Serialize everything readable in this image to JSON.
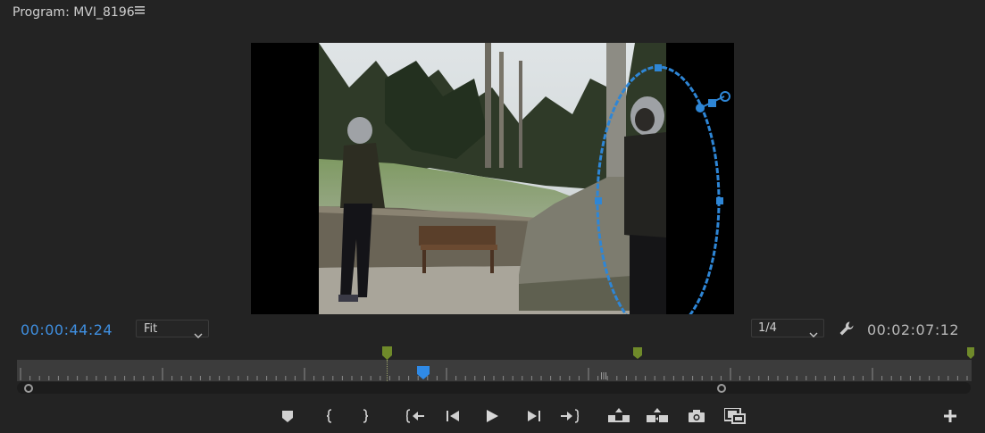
{
  "panel": {
    "title": "Program: MVI_8196",
    "menu_icon": "hamburger-menu-icon"
  },
  "timecode": {
    "current": "00:00:44:24",
    "duration": "00:02:07:12"
  },
  "zoom": {
    "selected": "Fit"
  },
  "resolution": {
    "selected": "1/4"
  },
  "playhead": {
    "position_fraction": 0.426
  },
  "colors": {
    "accent": "#3f8fe0",
    "marker": "#6f8a2a",
    "mask": "#2e86d6"
  },
  "icons": {
    "settings": "wrench-icon",
    "add_marker": "marker-icon",
    "mark_in": "mark-in-icon",
    "mark_out": "mark-out-icon",
    "go_to_in": "go-to-in-icon",
    "step_back": "step-back-icon",
    "play": "play-icon",
    "step_forward": "step-forward-icon",
    "go_to_out": "go-to-out-icon",
    "lift": "lift-icon",
    "extract": "extract-icon",
    "export_frame": "camera-icon",
    "multi_camera": "film-icon",
    "add_button": "plus-icon"
  }
}
